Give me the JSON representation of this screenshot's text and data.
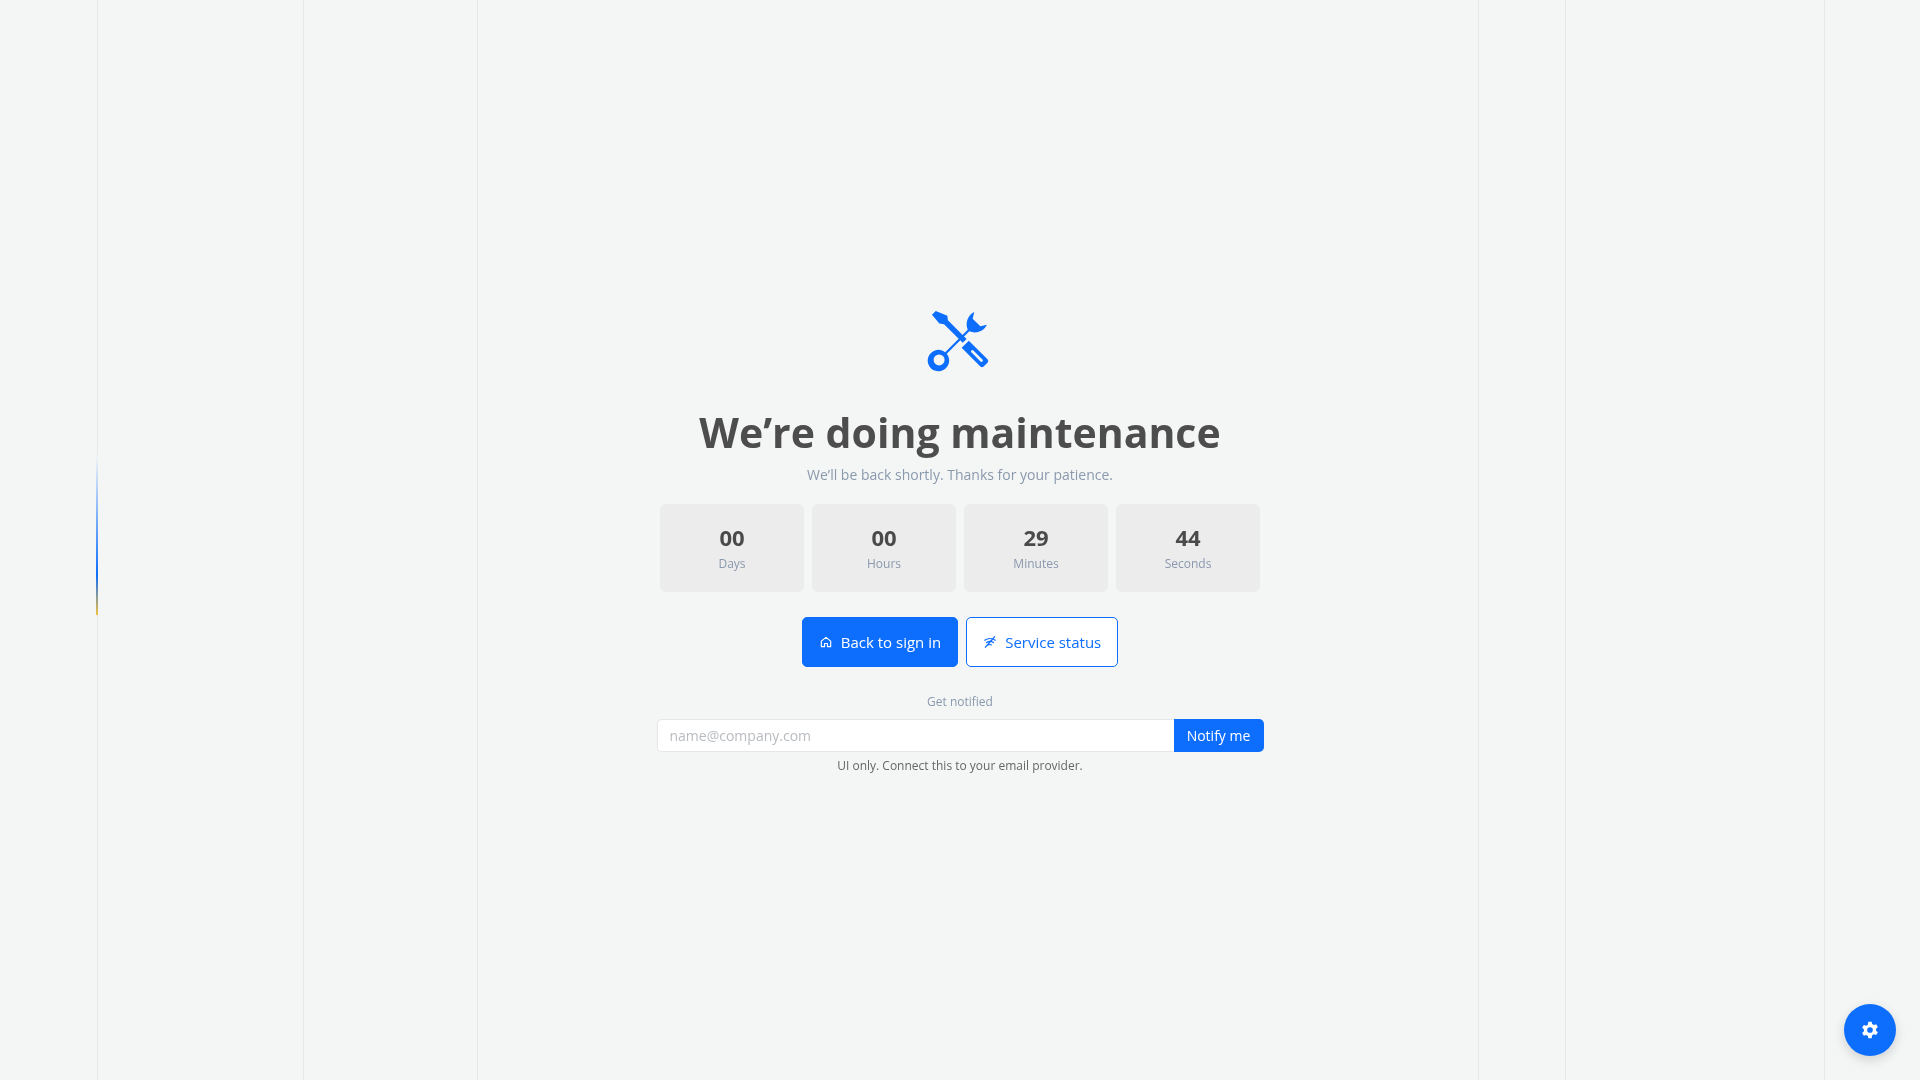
{
  "title": "We’re doing maintenance",
  "subtitle": "We’ll be back shortly. Thanks for your patience.",
  "countdown": [
    {
      "value": "00",
      "label": "Days"
    },
    {
      "value": "00",
      "label": "Hours"
    },
    {
      "value": "29",
      "label": "Minutes"
    },
    {
      "value": "44",
      "label": "Seconds"
    }
  ],
  "buttons": [
    {
      "label": "Back to sign in",
      "kind": "primary"
    },
    {
      "label": "Service status",
      "kind": "outline"
    }
  ],
  "notify": {
    "label": "Get notified",
    "placeholder": "name@company.com",
    "button": "Notify me",
    "hint": "UI only. Connect this to your email provider."
  }
}
